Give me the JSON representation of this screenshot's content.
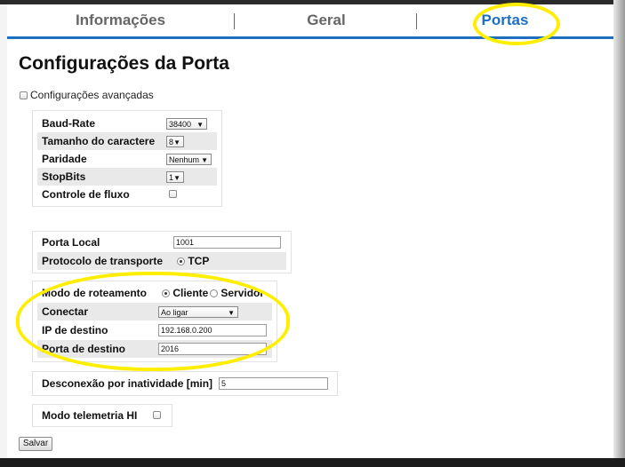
{
  "tabs": [
    {
      "label": "Informações"
    },
    {
      "label": "Geral"
    },
    {
      "label": "Portas"
    }
  ],
  "page_title": "Configurações da Porta",
  "advanced": {
    "label": "Configurações avançadas"
  },
  "serial": {
    "baud": {
      "label": "Baud-Rate",
      "value": "38400"
    },
    "charsize": {
      "label": "Tamanho do caractere",
      "value": "8"
    },
    "parity": {
      "label": "Paridade",
      "value": "Nenhum"
    },
    "stopbits": {
      "label": "StopBits",
      "value": "1"
    },
    "flow": {
      "label": "Controle de fluxo"
    }
  },
  "network": {
    "local_port": {
      "label": "Porta Local",
      "value": "1001"
    },
    "protocol": {
      "label": "Protocolo de transporte",
      "option": "TCP"
    }
  },
  "routing": {
    "mode": {
      "label": "Modo de roteamento",
      "client": "Cliente",
      "server": "Servidor"
    },
    "connect": {
      "label": "Conectar",
      "value": "Ao ligar"
    },
    "dest_ip": {
      "label": "IP de destino",
      "value": "192.168.0.200"
    },
    "dest_port": {
      "label": "Porta de destino",
      "value": "2016"
    }
  },
  "inactivity": {
    "label": "Desconexão por inatividade [min]",
    "value": "5"
  },
  "telemetry": {
    "label": "Modo telemetria HI"
  },
  "save_button": "Salvar",
  "colors": {
    "accent": "#1e6fbf",
    "highlight": "#ffee00"
  }
}
